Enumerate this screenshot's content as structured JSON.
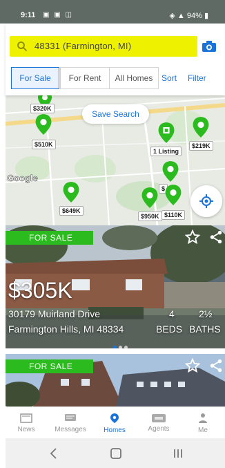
{
  "status_bar": {
    "time": "9:11",
    "battery": "94%"
  },
  "search": {
    "value": "48331 (Farmington, MI)"
  },
  "filters": {
    "tabs": [
      {
        "label": "For Sale",
        "active": true
      },
      {
        "label": "For Rent",
        "active": false
      },
      {
        "label": "All Homes",
        "active": false
      }
    ],
    "sort_label": "Sort",
    "filter_label": "Filter"
  },
  "map": {
    "save_search_label": "Save Search",
    "google_label": "Google",
    "pins": [
      {
        "label": "$320K"
      },
      {
        "label": "$510K"
      },
      {
        "label": "1 Listing"
      },
      {
        "label": "$219K"
      },
      {
        "label": "$649K"
      },
      {
        "label": "$950K"
      },
      {
        "label": "$110K"
      },
      {
        "label": "$"
      }
    ]
  },
  "listings": [
    {
      "badge": "FOR SALE",
      "price": "$305K",
      "address": "30179 Muirland Drive",
      "city": "Farmington Hills, MI 48334",
      "beds": "4",
      "beds_label": "BEDS",
      "baths": "2½",
      "baths_label": "BATHS"
    },
    {
      "badge": "FOR SALE"
    }
  ],
  "bottom_nav": [
    {
      "label": "News",
      "icon": "news-icon",
      "active": false
    },
    {
      "label": "Messages",
      "icon": "messages-icon",
      "active": false
    },
    {
      "label": "Homes",
      "icon": "location-pin-icon",
      "active": true
    },
    {
      "label": "Agents",
      "icon": "pro-badge-icon",
      "active": false
    },
    {
      "label": "Me",
      "icon": "person-icon",
      "active": false
    }
  ],
  "colors": {
    "accent": "#1a73d9",
    "pin_green": "#2bbb1e",
    "highlight": "#eef100"
  }
}
